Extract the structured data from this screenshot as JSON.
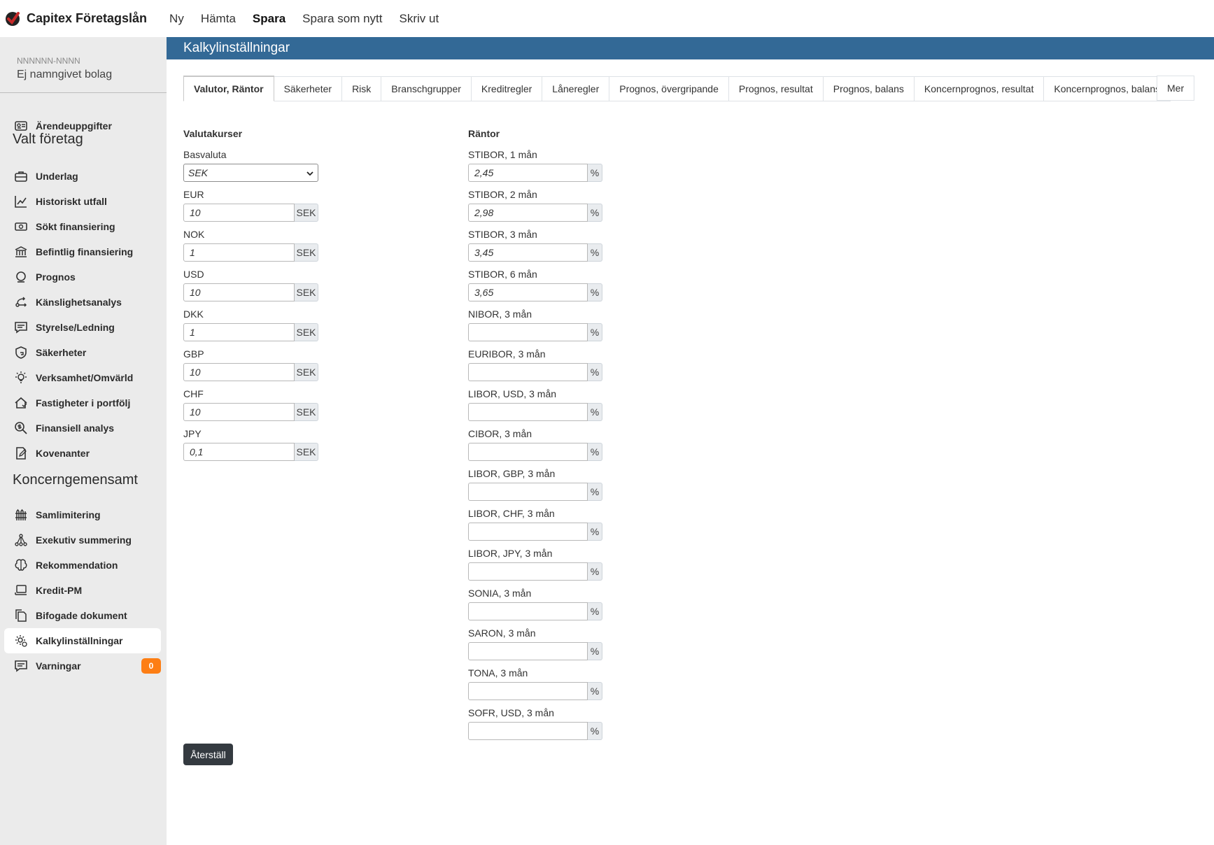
{
  "app": {
    "brand": "Capitex Företagslån",
    "nav": [
      "Ny",
      "Hämta",
      "Spara",
      "Spara som nytt",
      "Skriv ut"
    ]
  },
  "company": {
    "id": "NNNNNN-NNNN",
    "name": "Ej namngivet bolag"
  },
  "sidebar": {
    "top_item": "Ärendeuppgifter",
    "section1": "Valt företag",
    "section1_items": [
      "Underlag",
      "Historiskt utfall",
      "Sökt finansiering",
      "Befintlig finansiering",
      "Prognos",
      "Känslighetsanalys",
      "Styrelse/Ledning",
      "Säkerheter",
      "Verksamhet/Omvärld",
      "Fastigheter i portfölj",
      "Finansiell analys",
      "Kovenanter"
    ],
    "section2": "Koncerngemensamt",
    "section2_items": [
      "Samlimitering",
      "Exekutiv summering",
      "Rekommendation",
      "Kredit-PM",
      "Bifogade dokument",
      "Kalkylinställningar",
      "Varningar"
    ],
    "warnings_count": "0",
    "active_item": "Kalkylinställningar"
  },
  "page": {
    "title": "Kalkylinställningar"
  },
  "tabs": [
    "Valutor, Räntor",
    "Säkerheter",
    "Risk",
    "Branschgrupper",
    "Kreditregler",
    "Låneregler",
    "Prognos, övergripande",
    "Prognos, resultat",
    "Prognos, balans",
    "Koncernprognos, resultat",
    "Koncernprognos, balans"
  ],
  "tab_more": "Mer",
  "active_tab": "Valutor, Räntor",
  "currencies": {
    "title": "Valutakurser",
    "base_label": "Basvaluta",
    "base_value": "SEK",
    "unit": "SEK",
    "rows": [
      {
        "label": "EUR",
        "value": "10"
      },
      {
        "label": "NOK",
        "value": "1"
      },
      {
        "label": "USD",
        "value": "10"
      },
      {
        "label": "DKK",
        "value": "1"
      },
      {
        "label": "GBP",
        "value": "10"
      },
      {
        "label": "CHF",
        "value": "10"
      },
      {
        "label": "JPY",
        "value": "0,1"
      }
    ]
  },
  "rates": {
    "title": "Räntor",
    "unit": "%",
    "rows": [
      {
        "label": "STIBOR, 1 mån",
        "value": "2,45"
      },
      {
        "label": "STIBOR, 2 mån",
        "value": "2,98"
      },
      {
        "label": "STIBOR, 3 mån",
        "value": "3,45"
      },
      {
        "label": "STIBOR, 6 mån",
        "value": "3,65"
      },
      {
        "label": "NIBOR, 3 mån",
        "value": ""
      },
      {
        "label": "EURIBOR, 3 mån",
        "value": ""
      },
      {
        "label": "LIBOR, USD, 3 mån",
        "value": ""
      },
      {
        "label": "CIBOR, 3 mån",
        "value": ""
      },
      {
        "label": "LIBOR, GBP, 3 mån",
        "value": ""
      },
      {
        "label": "LIBOR, CHF, 3 mån",
        "value": ""
      },
      {
        "label": "LIBOR, JPY, 3 mån",
        "value": ""
      },
      {
        "label": "SONIA, 3 mån",
        "value": ""
      },
      {
        "label": "SARON, 3 mån",
        "value": ""
      },
      {
        "label": "TONA, 3 mån",
        "value": ""
      },
      {
        "label": "SOFR, USD, 3 mån",
        "value": ""
      }
    ]
  },
  "reset_button": "Återställ",
  "colors": {
    "header": "#336996",
    "sidebar": "#ebebeb",
    "badge": "#fd7e14",
    "button": "#343a40"
  }
}
